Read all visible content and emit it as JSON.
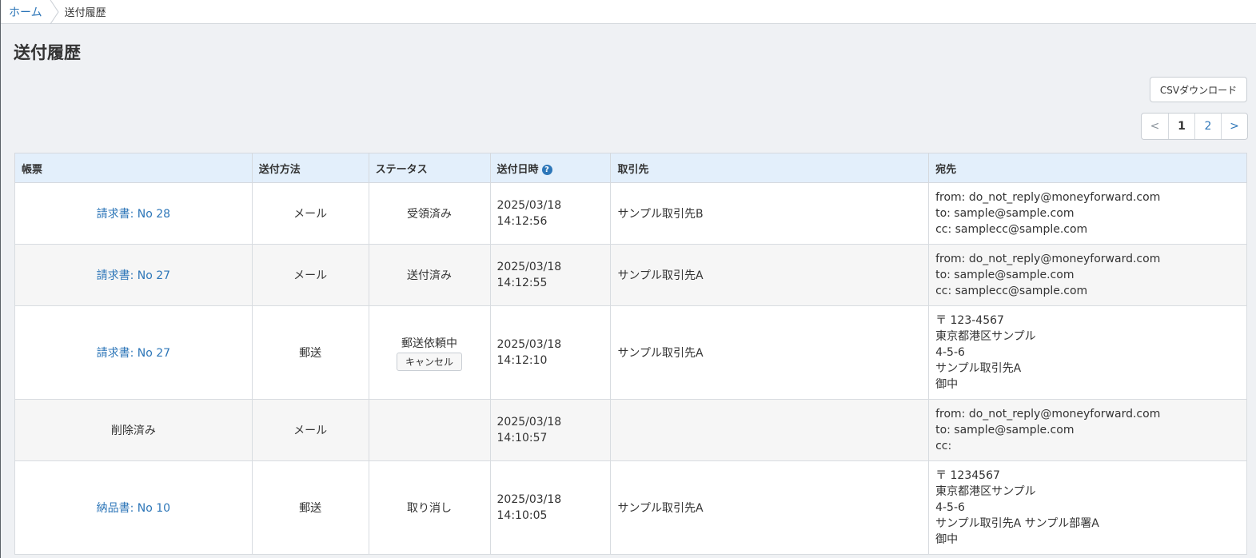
{
  "breadcrumb": {
    "home": "ホーム",
    "current": "送付履歴"
  },
  "page": {
    "title": "送付履歴"
  },
  "toolbar": {
    "csv_label": "CSVダウンロード"
  },
  "pagination": {
    "prev": "<",
    "pages": [
      "1",
      "2"
    ],
    "current": "1",
    "next": ">"
  },
  "table": {
    "headers": [
      "帳票",
      "送付方法",
      "ステータス",
      "送付日時",
      "取引先",
      "宛先"
    ],
    "rows": [
      {
        "document": "請求書: No 28",
        "document_link": true,
        "method": "メール",
        "status": "受領済み",
        "date": "2025/03/18",
        "time": "14:12:56",
        "partner": "サンプル取引先B",
        "dest": [
          "from: do_not_reply@moneyforward.com",
          "to: sample@sample.com",
          "cc: samplecc@sample.com"
        ]
      },
      {
        "document": "請求書: No 27",
        "document_link": true,
        "method": "メール",
        "status": "送付済み",
        "date": "2025/03/18",
        "time": "14:12:55",
        "partner": "サンプル取引先A",
        "dest": [
          "from: do_not_reply@moneyforward.com",
          "to: sample@sample.com",
          "cc: samplecc@sample.com"
        ]
      },
      {
        "document": "請求書: No 27",
        "document_link": true,
        "method": "郵送",
        "status": "郵送依頼中",
        "action": "キャンセル",
        "date": "2025/03/18",
        "time": "14:12:10",
        "partner": "サンプル取引先A",
        "dest": [
          "〒 123-4567",
          "東京都港区サンプル",
          "4-5-6",
          "サンプル取引先A",
          "御中"
        ]
      },
      {
        "document": "削除済み",
        "document_link": false,
        "method": "メール",
        "status": "",
        "date": "2025/03/18",
        "time": "14:10:57",
        "partner": "",
        "dest": [
          "from: do_not_reply@moneyforward.com",
          "to: sample@sample.com",
          "cc:"
        ]
      },
      {
        "document": "納品書: No 10",
        "document_link": true,
        "method": "郵送",
        "status": "取り消し",
        "date": "2025/03/18",
        "time": "14:10:05",
        "partner": "サンプル取引先A",
        "dest": [
          "〒 1234567",
          "東京都港区サンプル",
          "4-5-6",
          "サンプル取引先A サンプル部署A",
          "御中"
        ]
      }
    ]
  },
  "icons": {
    "help": "question-circle-icon",
    "breadcrumb_separator": "chevron-right-icon"
  }
}
